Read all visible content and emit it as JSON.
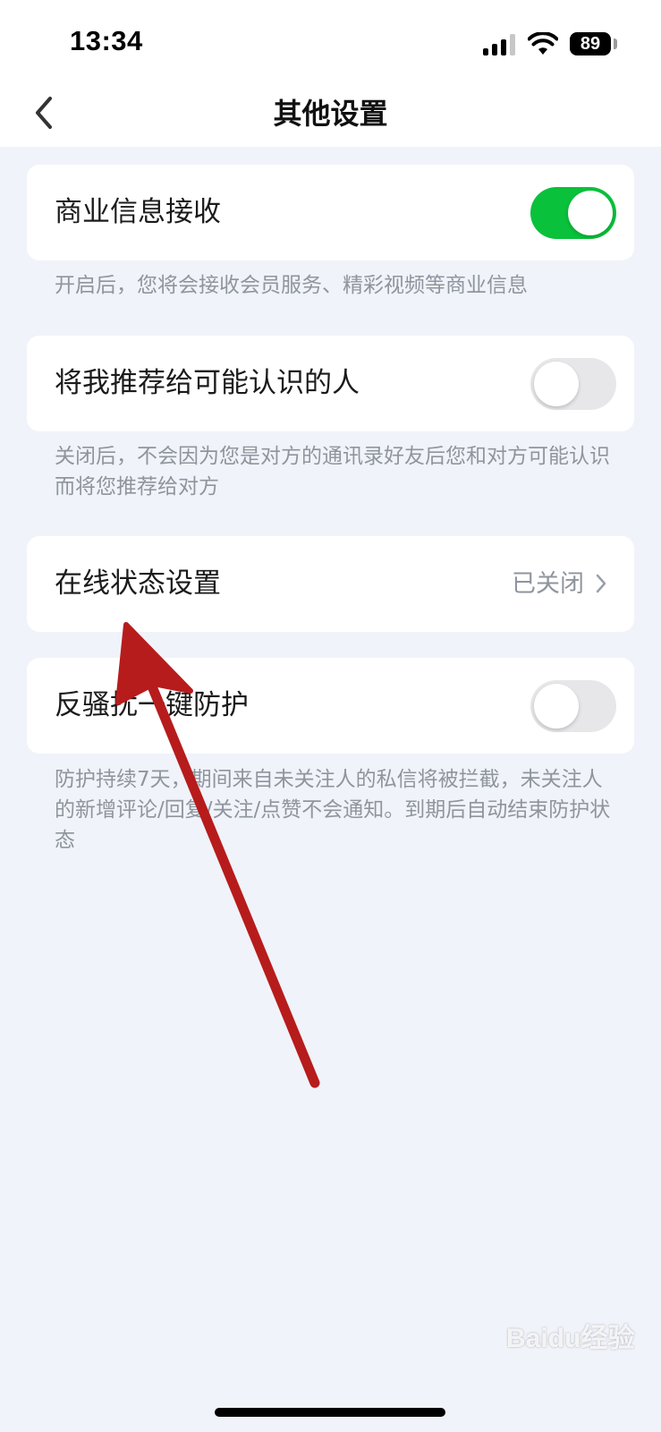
{
  "status_bar": {
    "time": "13:34",
    "battery": "89",
    "signal_icon": "signal-icon",
    "wifi_icon": "wifi-icon"
  },
  "nav": {
    "title": "其他设置",
    "back_icon": "chevron-left-icon"
  },
  "settings": {
    "commercial": {
      "label": "商业信息接收",
      "enabled": true,
      "description": "开启后，您将会接收会员服务、精彩视频等商业信息"
    },
    "recommend": {
      "label": "将我推荐给可能认识的人",
      "enabled": false,
      "description": "关闭后，不会因为您是对方的通讯录好友后您和对方可能认识而将您推荐给对方"
    },
    "online_status": {
      "label": "在线状态设置",
      "value": "已关闭",
      "chevron_icon": "chevron-right-icon"
    },
    "anti_harass": {
      "label": "反骚扰一键防护",
      "enabled": false,
      "description": "防护持续7天，期间来自未关注人的私信将被拦截，未关注人的新增评论/回复/关注/点赞不会通知。到期后自动结束防护状态"
    }
  },
  "colors": {
    "toggle_on": "#0ac13b",
    "toggle_off": "#e7e7ea",
    "page_background": "#f0f3f9",
    "annotation_arrow": "#b71c1c"
  },
  "watermark": {
    "text": "Baidu经验"
  }
}
